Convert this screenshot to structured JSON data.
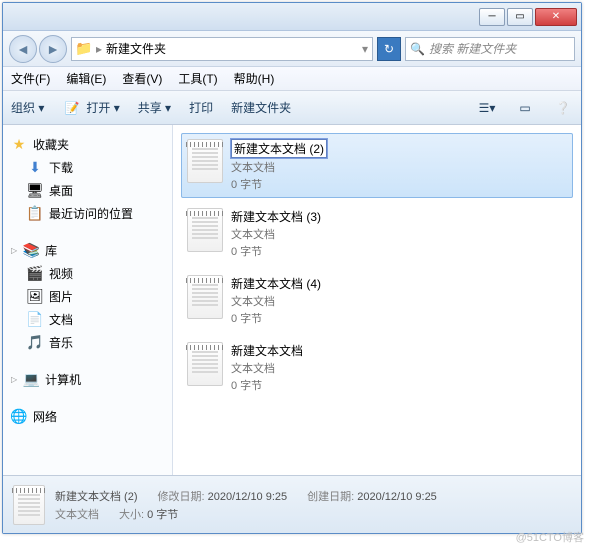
{
  "window": {
    "folder_name": "新建文件夹",
    "search_placeholder": "搜索 新建文件夹"
  },
  "menubar": {
    "file": "文件(F)",
    "edit": "编辑(E)",
    "view": "查看(V)",
    "tools": "工具(T)",
    "help": "帮助(H)"
  },
  "toolbar": {
    "organize": "组织 ▾",
    "open": "打开 ▾",
    "share": "共享 ▾",
    "print": "打印",
    "newfolder": "新建文件夹"
  },
  "sidebar": {
    "favorites": {
      "label": "收藏夹",
      "items": [
        {
          "icon": "⬇",
          "label": "下载"
        },
        {
          "icon": "🖥",
          "label": "桌面"
        },
        {
          "icon": "📋",
          "label": "最近访问的位置"
        }
      ]
    },
    "libraries": {
      "label": "库",
      "items": [
        {
          "icon": "🎬",
          "label": "视频"
        },
        {
          "icon": "🖼",
          "label": "图片"
        },
        {
          "icon": "📄",
          "label": "文档"
        },
        {
          "icon": "🎵",
          "label": "音乐"
        }
      ]
    },
    "computer": {
      "label": "计算机"
    },
    "network": {
      "label": "网络"
    }
  },
  "files": [
    {
      "name": "新建文本文档 (2)",
      "type": "文本文档",
      "size": "0 字节",
      "selected": true,
      "editing": true
    },
    {
      "name": "新建文本文档 (3)",
      "type": "文本文档",
      "size": "0 字节",
      "selected": false,
      "editing": false
    },
    {
      "name": "新建文本文档 (4)",
      "type": "文本文档",
      "size": "0 字节",
      "selected": false,
      "editing": false
    },
    {
      "name": "新建文本文档",
      "type": "文本文档",
      "size": "0 字节",
      "selected": false,
      "editing": false
    }
  ],
  "status": {
    "name": "新建文本文档 (2)",
    "type": "文本文档",
    "mod_label": "修改日期:",
    "mod_value": "2020/12/10 9:25",
    "create_label": "创建日期:",
    "create_value": "2020/12/10 9:25",
    "size_label": "大小:",
    "size_value": "0 字节"
  },
  "watermark": "@51CTO博客"
}
